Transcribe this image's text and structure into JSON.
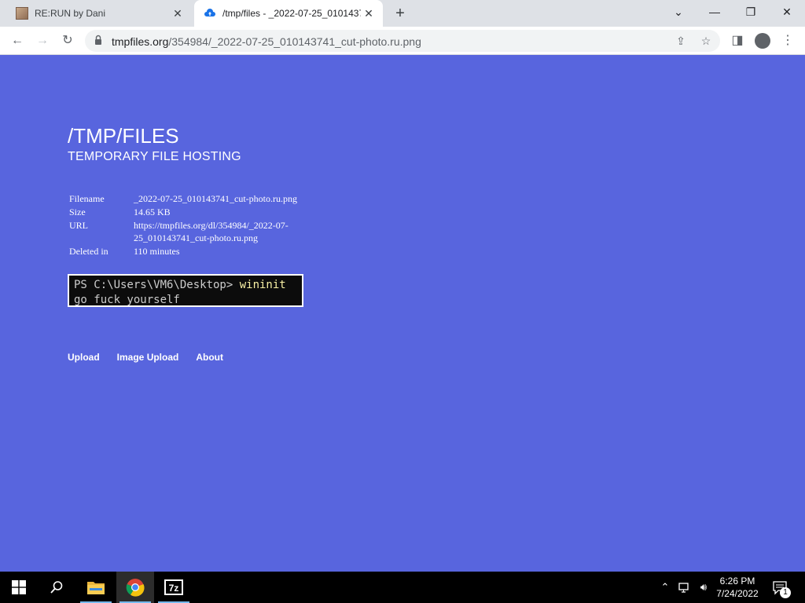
{
  "browser": {
    "tabs": [
      {
        "title": "RE:RUN by Dani",
        "active": false
      },
      {
        "title": "/tmp/files - _2022-07-25_010143741_cut-photo.ru.png",
        "active": true
      }
    ],
    "address": {
      "host": "tmpfiles.org",
      "path": "/354984/_2022-07-25_010143741_cut-photo.ru.png"
    }
  },
  "site": {
    "title": "/TMP/FILES",
    "subtitle": "TEMPORARY FILE HOSTING",
    "info": [
      {
        "label": "Filename",
        "value": "_2022-07-25_010143741_cut-photo.ru.png"
      },
      {
        "label": "Size",
        "value": "14.65 KB"
      },
      {
        "label": "URL",
        "value": "https://tmpfiles.org/dl/354984/_2022-07-25_010143741_cut-photo.ru.png"
      },
      {
        "label": "Deleted in",
        "value": "110 minutes"
      }
    ],
    "preview": {
      "prompt": "PS C:\\Users\\VM6\\Desktop> ",
      "command": "wininit",
      "output": "go fuck yourself"
    },
    "footer_links": [
      "Upload",
      "Image Upload",
      "About"
    ]
  },
  "taskbar": {
    "time": "6:26 PM",
    "date": "7/24/2022",
    "notification_count": "1"
  },
  "colors": {
    "page_bg": "#5865de",
    "tab_strip": "#dee1e6",
    "taskbar": "#000000"
  }
}
